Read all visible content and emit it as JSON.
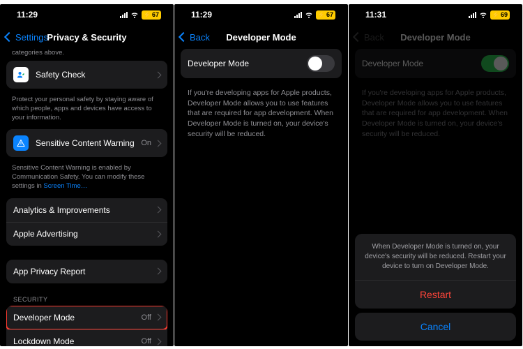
{
  "screen1": {
    "time": "11:29",
    "battery": "67",
    "back_label": "Settings",
    "title": "Privacy & Security",
    "truncated_note": "categories above.",
    "safety_check": {
      "label": "Safety Check"
    },
    "safety_check_footnote": "Protect your personal safety by staying aware of which people, apps and devices have access to your information.",
    "scw": {
      "label": "Sensitive Content Warning",
      "value": "On"
    },
    "scw_footnote_pre": "Sensitive Content Warning is enabled by Communication Safety. You can modify these settings in ",
    "scw_footnote_link": "Screen Time…",
    "analytics": {
      "label": "Analytics & Improvements"
    },
    "advertising": {
      "label": "Apple Advertising"
    },
    "app_privacy": {
      "label": "App Privacy Report"
    },
    "security_header": "SECURITY",
    "dev_mode": {
      "label": "Developer Mode",
      "value": "Off"
    },
    "lockdown": {
      "label": "Lockdown Mode",
      "value": "Off"
    }
  },
  "screen2": {
    "time": "11:29",
    "battery": "67",
    "back_label": "Back",
    "title": "Developer Mode",
    "row_label": "Developer Mode",
    "toggle_state": "off",
    "description": "If you're developing apps for Apple products, Developer Mode allows you to use features that are required for app development. When Developer Mode is turned on, your device's security will be reduced."
  },
  "screen3": {
    "time": "11:31",
    "battery": "69",
    "back_label": "Back",
    "title": "Developer Mode",
    "row_label": "Developer Mode",
    "toggle_state": "on",
    "description": "If you're developing apps for Apple products, Developer Mode allows you to use features that are required for app development. When Developer Mode is turned on, your device's security will be reduced.",
    "sheet": {
      "message": "When Developer Mode is turned on, your device's security will be reduced. Restart your device to turn on Developer Mode.",
      "restart": "Restart",
      "cancel": "Cancel"
    }
  }
}
